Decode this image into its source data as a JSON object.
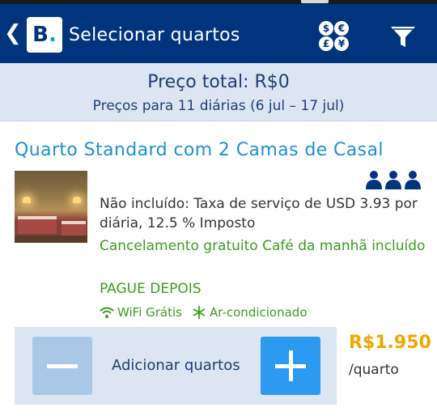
{
  "app_bar": {
    "title": "Selecionar quartos",
    "logo_text": "B",
    "back_icon": "chevron-left-icon",
    "currency_icon": "currency-icon",
    "filter_icon": "filter-icon",
    "currency_symbols": [
      "$",
      "€",
      "£",
      "¥"
    ]
  },
  "price_summary": {
    "total": "Preço total: R$0",
    "subtitle": "Preços para 11 diárias (6 jul – 17 jul)"
  },
  "room": {
    "title": "Quarto Standard com 2 Camas de Casal",
    "guests_icon": "three-persons-icon",
    "not_included": "Não incluído: Taxa de serviço de USD 3.93 por diária, 12.5 % Imposto",
    "cancellation": "Cancelamento gratuito  Café da manhã incluído",
    "pay_later": "PAGUE DEPOIS",
    "amenities": [
      {
        "icon": "wifi-icon",
        "label": "WiFi Grátis"
      },
      {
        "icon": "snowflake-icon",
        "label": "Ar-condicionado"
      }
    ],
    "price": "R$1.950",
    "per_room": "/quarto"
  },
  "quantity": {
    "label": "Adicionar quartos",
    "minus_icon": "minus-icon",
    "plus_icon": "plus-icon"
  },
  "colors": {
    "app_bar": "#00357e",
    "summary_bg": "#dbe6f2",
    "room_title": "#1e90d2",
    "green_text": "#3a9e1e",
    "price": "#f0a800",
    "plus_button": "#2b9af0",
    "minus_button": "#a9c8e8"
  }
}
